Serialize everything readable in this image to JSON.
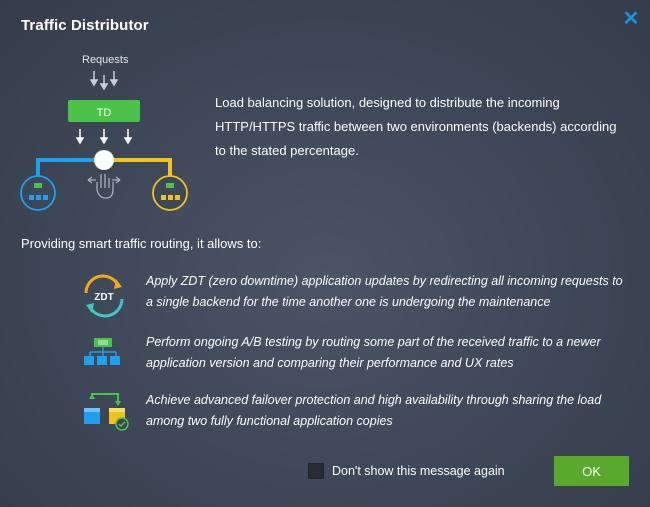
{
  "dialog": {
    "title": "Traffic Distributor",
    "close_icon": "close-icon"
  },
  "diagram": {
    "requests_label": "Requests",
    "td_label": "TD",
    "colors": {
      "td": "#4cc24a",
      "left": "#1ea0ee",
      "right": "#f0c419",
      "node": "#ffffff"
    }
  },
  "intro": {
    "text": "Load balancing solution, designed to distribute the incoming HTTP/HTTPS traffic between two environments (backends) according to the stated percentage."
  },
  "allows_heading": "Providing smart traffic routing, it allows to:",
  "features": [
    {
      "icon": "zdt-icon",
      "text": "Apply ZDT (zero downtime) application updates by redirecting all incoming requests to a single backend for the time another one is undergoing the maintenance",
      "icon_label": "ZDT"
    },
    {
      "icon": "ab-testing-icon",
      "text": "Perform ongoing A/B testing by routing some part of the received traffic to a newer application version and comparing their performance and UX rates"
    },
    {
      "icon": "failover-icon",
      "text": "Achieve advanced failover protection and high availability through sharing the load among two fully functional application copies"
    }
  ],
  "footer": {
    "dont_show_label": "Don't show this message again",
    "ok_label": "OK"
  }
}
